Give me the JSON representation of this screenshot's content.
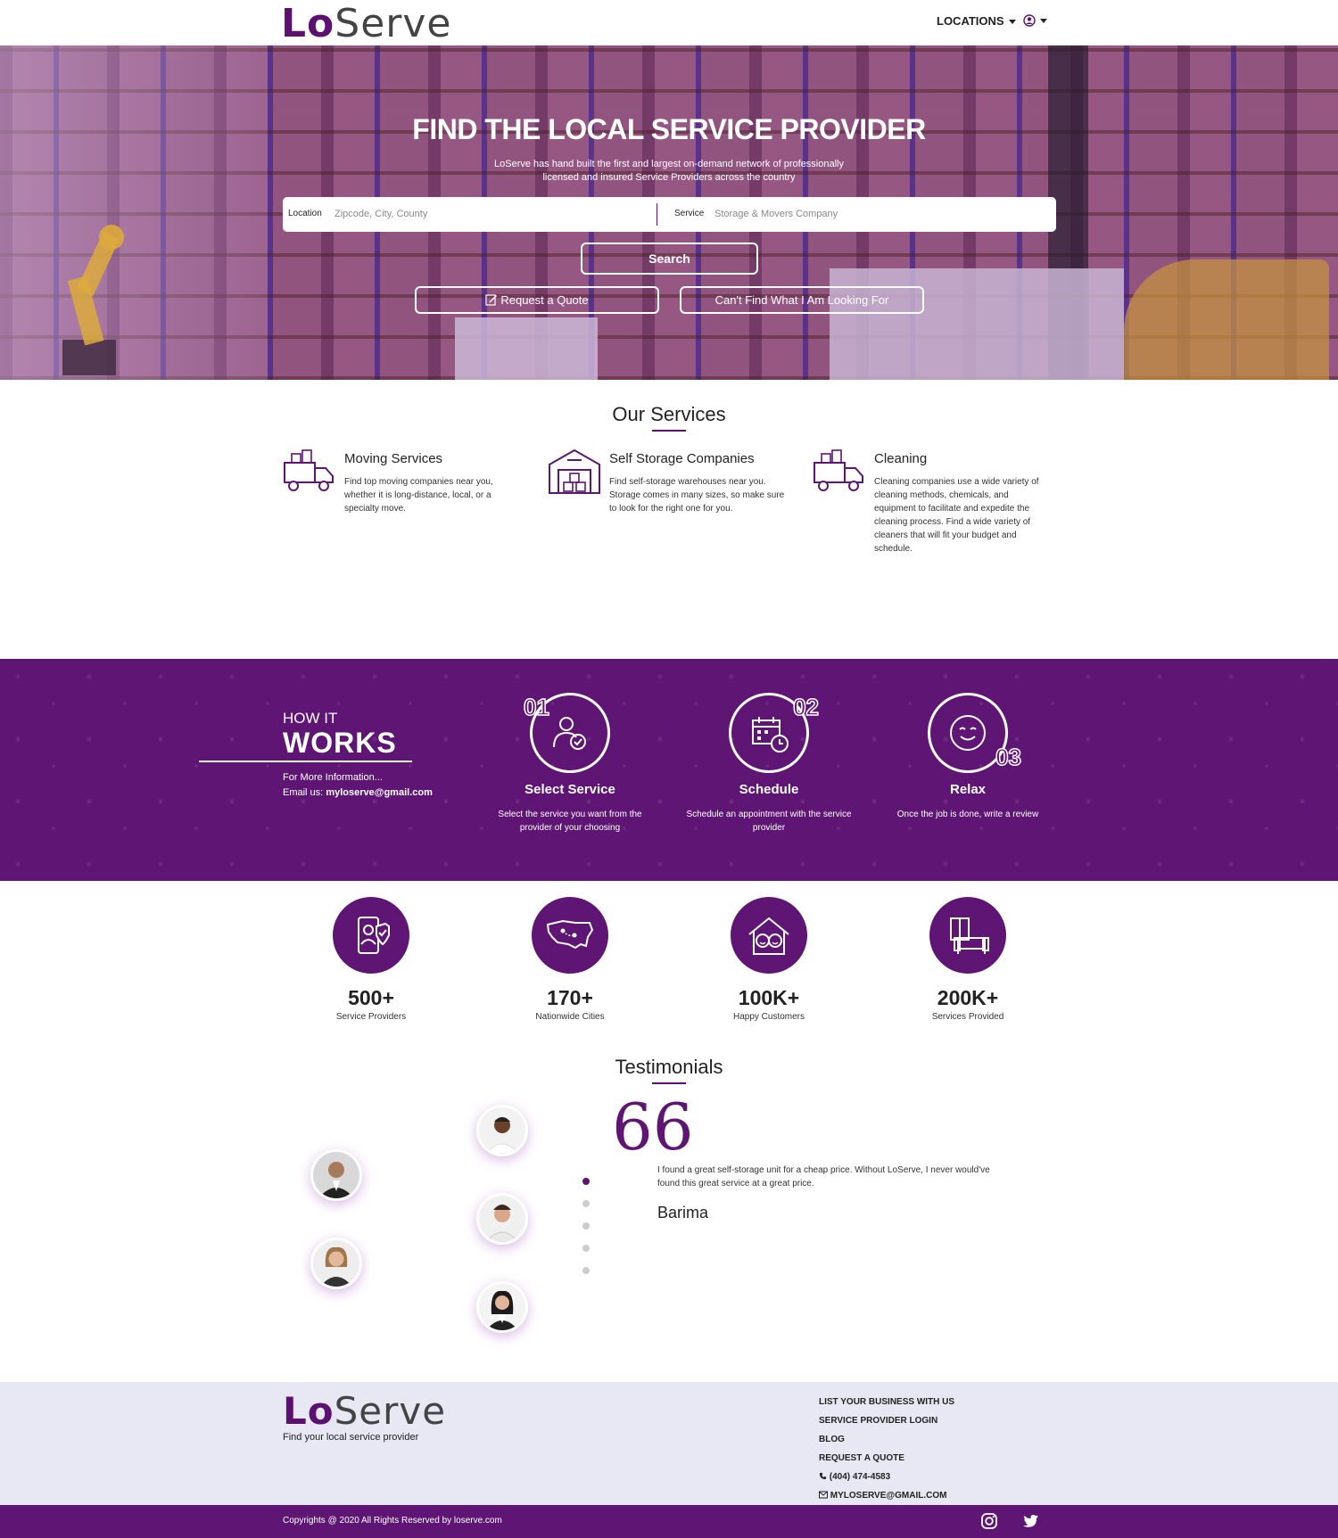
{
  "header": {
    "logo_lo": "Lo",
    "logo_serve": "Serve",
    "locations_label": "LOCATIONS"
  },
  "hero": {
    "title": "FIND THE LOCAL SERVICE PROVIDER",
    "subtitle": "LoServe has hand built the first and largest on-demand network of professionally licensed and insured Service Providers across the country",
    "location_label": "Location",
    "location_placeholder": "Zipcode, City, County",
    "service_label": "Service",
    "service_placeholder": "Storage & Movers Company",
    "search_button": "Search",
    "quote_button": "Request a Quote",
    "cant_find_button": "Can't Find What I Am Looking For"
  },
  "services": {
    "title": "Our Services",
    "items": [
      {
        "name": "Moving Services",
        "desc": "Find top moving companies near you, whether it is long-distance, local, or a specialty move.",
        "icon": "moving-truck-icon"
      },
      {
        "name": "Self Storage Companies",
        "desc": "Find self-storage warehouses near you. Storage comes in many sizes, so make sure to look for the right one for you.",
        "icon": "warehouse-icon"
      },
      {
        "name": "Cleaning",
        "desc": "Cleaning companies use a wide variety of cleaning methods, chemicals, and equipment to facilitate and expedite the cleaning process. Find a wide variety of cleaners that will fit your budget and schedule.",
        "icon": "cleaning-truck-icon"
      }
    ]
  },
  "how": {
    "small": "HOW IT",
    "big": "WORKS",
    "info_line": "For More Information...",
    "email_label": "Email us:",
    "email": "myloserve@gmail.com",
    "steps": [
      {
        "num": "01",
        "title": "Select Service",
        "desc": "Select the service you want from the provider of your choosing"
      },
      {
        "num": "02",
        "title": "Schedule",
        "desc": "Schedule an appointment with the service provider"
      },
      {
        "num": "03",
        "title": "Relax",
        "desc": "Once the job is done, write a review"
      }
    ]
  },
  "stats": [
    {
      "value": "500+",
      "label": "Service Providers",
      "icon": "mobile-provider-icon"
    },
    {
      "value": "170+",
      "label": "Nationwide Cities",
      "icon": "usa-map-icon"
    },
    {
      "value": "100K+",
      "label": "Happy Customers",
      "icon": "happy-home-icon"
    },
    {
      "value": "200K+",
      "label": "Services Provided",
      "icon": "furniture-icon"
    }
  ],
  "testimonials": {
    "title": "Testimonials",
    "quote_mark": "66",
    "text": "I found a great self-storage unit for a cheap price. Without LoServe, I never would've found this great service at a great price.",
    "name": "Barima",
    "active_index": 0,
    "dot_count": 5
  },
  "footer": {
    "logo_lo": "Lo",
    "logo_serve": "Serve",
    "tagline": "Find your local service provider",
    "links": [
      "LIST YOUR BUSINESS WITH US",
      "SERVICE PROVIDER LOGIN",
      "BLOG",
      "REQUEST A QUOTE"
    ],
    "phone": "(404) 474-4583",
    "email": "MYLOSERVE@GMAIL.COM",
    "copyright": "Copyrights @ 2020 All Rights Reserved by loserve.com"
  },
  "colors": {
    "brand": "#5e1573",
    "footer_bg": "#e7e8f3"
  }
}
